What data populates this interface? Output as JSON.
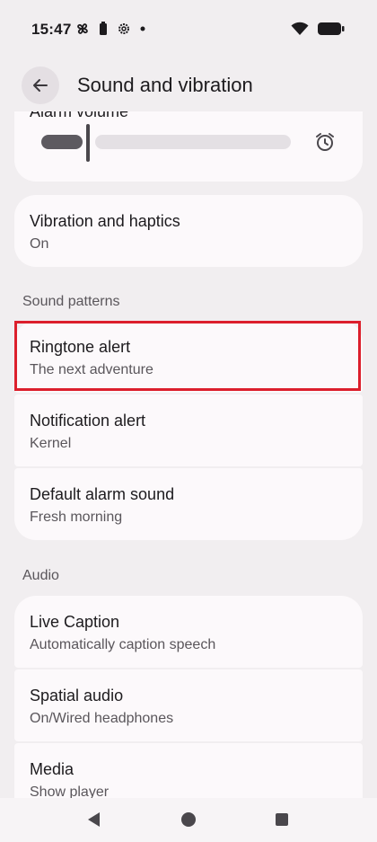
{
  "status": {
    "time": "15:47"
  },
  "app_bar": {
    "title": "Sound and vibration"
  },
  "alarm": {
    "label": "Alarm volume",
    "volume_percent": 18
  },
  "vibration": {
    "title": "Vibration and haptics",
    "value": "On"
  },
  "sections": {
    "sound_patterns": "Sound patterns",
    "audio": "Audio"
  },
  "ringtone": {
    "title": "Ringtone alert",
    "value": "The next adventure"
  },
  "notification": {
    "title": "Notification alert",
    "value": "Kernel"
  },
  "alarm_sound": {
    "title": "Default alarm sound",
    "value": "Fresh morning"
  },
  "live_caption": {
    "title": "Live Caption",
    "value": "Automatically caption speech"
  },
  "spatial": {
    "title": "Spatial audio",
    "value": "On/Wired headphones"
  },
  "media": {
    "title": "Media",
    "value": "Show player"
  },
  "colors": {
    "accent": "#dc1f2c",
    "background": "#f1eef0",
    "card": "#fcf9fb"
  }
}
